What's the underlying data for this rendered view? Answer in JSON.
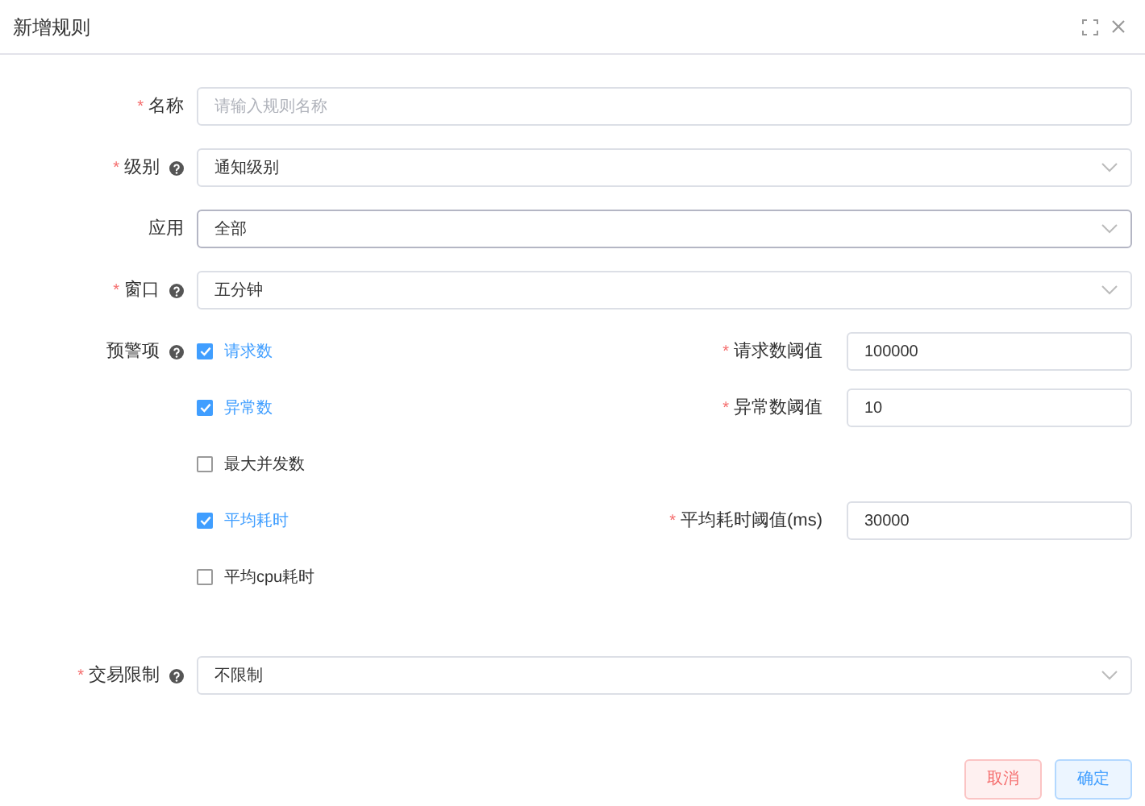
{
  "dialog": {
    "title": "新增规则"
  },
  "form": [
    {
      "kind": "input",
      "label": "名称",
      "required_mark": "*",
      "help": false,
      "placeholder": "请输入规则名称",
      "focused": false
    },
    {
      "kind": "select",
      "label": "级别",
      "required_mark": "*",
      "help": true,
      "value": "通知级别",
      "focused": false
    },
    {
      "kind": "select",
      "label": "应用",
      "help": false,
      "value": "全部",
      "focused": true
    },
    {
      "kind": "select",
      "label": "窗口",
      "required_mark": "*",
      "help": true,
      "value": "五分钟",
      "focused": false
    },
    {
      "kind": "checks",
      "label": "预警项",
      "help": true,
      "items": [
        {
          "label": "请求数",
          "checked": true,
          "threshold": {
            "required_mark": "*",
            "label": "请求数阈值",
            "value": "100000"
          }
        },
        {
          "label": "异常数",
          "checked": true,
          "threshold": {
            "required_mark": "*",
            "label": "异常数阈值",
            "value": "10"
          }
        },
        {
          "label": "最大并发数",
          "checked": false
        },
        {
          "label": "平均耗时",
          "checked": true,
          "threshold": {
            "required_mark": "*",
            "label": "平均耗时阈值(ms)",
            "value": "30000"
          }
        },
        {
          "label": "平均cpu耗时",
          "checked": false
        }
      ]
    },
    {
      "kind": "select",
      "label": "交易限制",
      "required_mark": "*",
      "help": true,
      "value": "不限制",
      "focused": false
    }
  ],
  "buttons": [
    {
      "label": "取消",
      "kind": "danger"
    },
    {
      "label": "确定",
      "kind": "primary"
    }
  ]
}
